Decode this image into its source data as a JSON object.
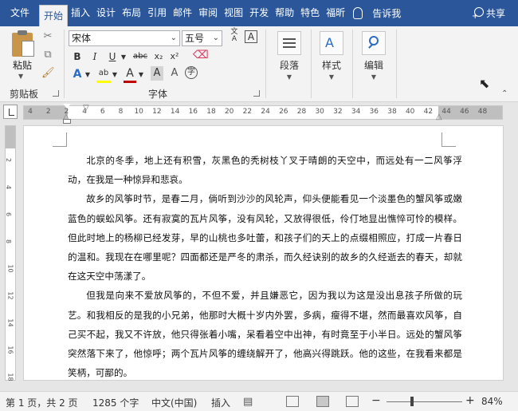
{
  "tabs": {
    "file": "文件",
    "home": "开始",
    "insert": "插入",
    "design": "设计",
    "layout": "布局",
    "references": "引用",
    "mailings": "邮件",
    "review": "审阅",
    "view": "视图",
    "developer": "开发",
    "help": "帮助",
    "tekiti": "特色",
    "foxit": "福昕",
    "tell_me": "告诉我",
    "share": "共享"
  },
  "clipboard": {
    "paste": "粘贴",
    "group_label": "剪贴板"
  },
  "font": {
    "name": "宋体",
    "size": "五号",
    "group_label": "字体",
    "bold": "B",
    "italic": "I",
    "underline": "U",
    "strikethrough": "abc",
    "subscript": "x₂",
    "superscript": "x²",
    "text_effects": "A",
    "highlight": "ab",
    "font_color": "A",
    "char_shading": "A",
    "phonetic": "文",
    "char_border": "A",
    "clear_format": "A",
    "enclose": "字",
    "case": "Aa",
    "highlight_color": "#ffff00",
    "font_color_value": "#c00000"
  },
  "paragraph": {
    "label": "段落"
  },
  "styles": {
    "label": "样式"
  },
  "editing": {
    "label": "编辑"
  },
  "ruler": {
    "ticks": [
      "4",
      "2",
      "2",
      "4",
      "6",
      "8",
      "10",
      "12",
      "14",
      "16",
      "18",
      "20",
      "22",
      "24",
      "26",
      "28",
      "30",
      "32",
      "34",
      "36",
      "38",
      "40",
      "42",
      "44",
      "46",
      "48"
    ],
    "v_ticks": [
      "2",
      "4",
      "6",
      "8",
      "10",
      "12",
      "14",
      "16",
      "18"
    ]
  },
  "document": {
    "paragraphs": [
      "北京的冬季，地上还有积雪，灰黑色的秃树枝丫叉于晴朗的天空中，而远处有一二风筝浮动，在我是一种惊异和悲哀。",
      "故乡的风筝时节，是春二月，倘听到沙沙的风轮声，仰头便能看见一个淡墨色的蟹风筝或嫩蓝色的蜈蚣风筝。还有寂寞的瓦片风筝，没有风轮，又放得很低，伶仃地显出憔悴可怜的模样。但此时地上的杨柳已经发芽，早的山桃也多吐蕾，和孩子们的天上的点缀相照应，打成一片春日的温和。我现在在哪里呢？四面都还是严冬的肃杀，而久经诀别的故乡的久经逝去的春天，却就在这天空中荡漾了。",
      "但我是向来不爱放风筝的，不但不爱，并且嫌恶它，因为我以为这是没出息孩子所做的玩艺。和我相反的是我的小兄弟，他那时大概十岁内外罢，多病，瘦得不堪，然而最喜欢风筝，自己买不起，我又不许放，他只得张着小嘴，呆看着空中出神，有时竟至于小半日。远处的蟹风筝突然落下来了，他惊呼；两个瓦片风筝的缠绕解开了，他高兴得跳跃。他的这些，在我看来都是笑柄，可鄙的。"
    ]
  },
  "status": {
    "page": "第 1 页，共 2 页",
    "words": "1285 个字",
    "language": "中文(中国)",
    "mode": "插入",
    "zoom": "84%",
    "zoom_minus": "−",
    "zoom_plus": "+"
  }
}
